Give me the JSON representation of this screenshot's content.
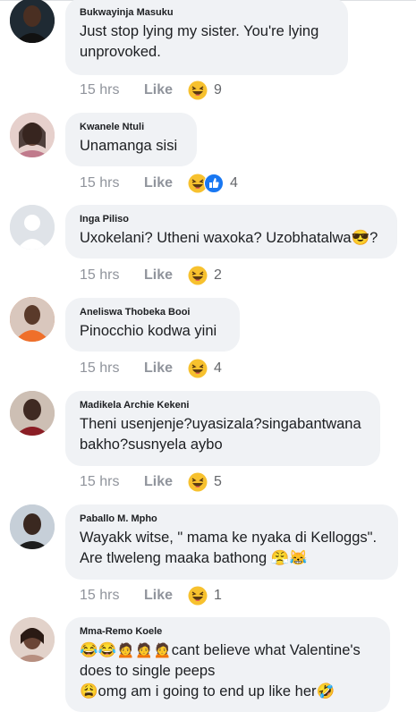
{
  "comments": [
    {
      "name": "Bukwayinja Masuku",
      "lines": [
        "Just stop lying my sister. You're lying",
        "unprovoked."
      ],
      "time": "15 hrs",
      "like": "Like",
      "reactions": [
        "haha"
      ],
      "count": "9",
      "avatar": {
        "bg": "#2b2b2b",
        "skin": "#4a2f22"
      }
    },
    {
      "name": "Kwanele Ntuli",
      "lines": [
        "Unamanga sisi"
      ],
      "time": "15 hrs",
      "like": "Like",
      "reactions": [
        "haha",
        "like"
      ],
      "count": "4",
      "avatar": {
        "bg": "#d9b9b2",
        "skin": "#6b4a3c"
      }
    },
    {
      "name": "Inga Piliso",
      "lines": [
        "Uxokelani? Utheni waxoka? Uzobhatalwa😎?"
      ],
      "time": "15 hrs",
      "like": "Like",
      "reactions": [
        "haha"
      ],
      "count": "2",
      "avatar": {
        "bg": "#dfe3e8",
        "skin": "#ffffff"
      }
    },
    {
      "name": "Aneliswa Thobeka Booi",
      "lines": [
        "Pinocchio kodwa yini"
      ],
      "time": "15 hrs",
      "like": "Like",
      "reactions": [
        "haha"
      ],
      "count": "4",
      "avatar": {
        "bg": "#e87a3c",
        "skin": "#5a3a2a"
      }
    },
    {
      "name": "Madikela Archie Kekeni",
      "lines": [
        "Theni usenjenje?uyasizala?singabantwana",
        "bakho?susnyela aybo"
      ],
      "time": "15 hrs",
      "like": "Like",
      "reactions": [
        "haha"
      ],
      "count": "5",
      "avatar": {
        "bg": "#c9b7a8",
        "skin": "#3f2a22"
      }
    },
    {
      "name": "Paballo M. Mpho",
      "lines": [
        "Wayakk witse, \" mama ke nyaka di Kelloggs\".",
        "Are tlweleng maaka bathong 😤😹"
      ],
      "time": "15 hrs",
      "like": "Like",
      "reactions": [
        "haha"
      ],
      "count": "1",
      "avatar": {
        "bg": "#b9c4cf",
        "skin": "#3a2820"
      }
    },
    {
      "name": "Mma-Remo Koele",
      "lines": [
        "😂😂🙍🙍🙍cant believe what Valentine's",
        "does to single peeps",
        "😩omg am i going to end up like her🤣"
      ],
      "time": "",
      "like": "",
      "reactions": [],
      "count": "",
      "avatar": {
        "bg": "#d7c2b8",
        "skin": "#6a4536"
      }
    }
  ]
}
